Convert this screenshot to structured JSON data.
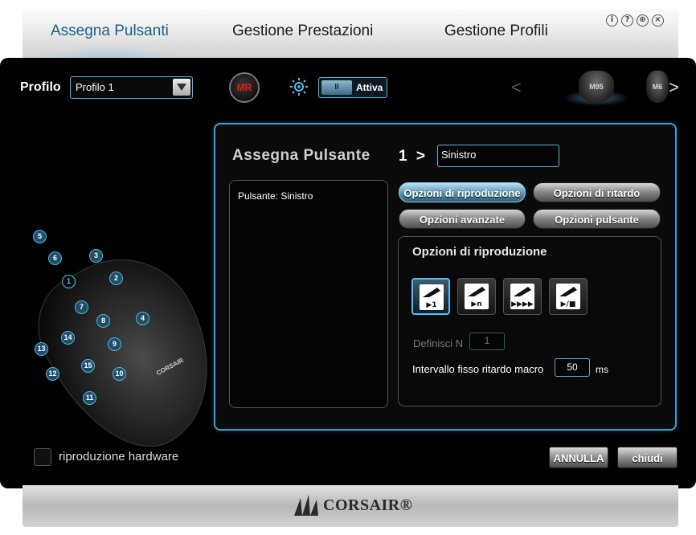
{
  "tabs": [
    {
      "label": "Assegna Pulsanti",
      "active": true
    },
    {
      "label": "Gestione Prestazioni",
      "active": false
    },
    {
      "label": "Gestione Profili",
      "active": false
    }
  ],
  "window_controls": [
    "info-icon",
    "help-icon",
    "globe-icon",
    "close-icon"
  ],
  "profile": {
    "label": "Profilo",
    "selected": "Profilo 1"
  },
  "macro_record": {
    "label": "MR"
  },
  "toggle": {
    "knob": "II",
    "label": "Attiva"
  },
  "mouse_carousel": {
    "items": [
      "M95",
      "M6"
    ]
  },
  "mouse_buttons": [
    "1",
    "2",
    "3",
    "4",
    "5",
    "6",
    "7",
    "8",
    "9",
    "10",
    "11",
    "12",
    "13",
    "14",
    "15"
  ],
  "mouse_brand": "CORSAIR",
  "assign": {
    "title": "Assegna Pulsante",
    "index": "1",
    "chevron": ">",
    "name_value": "Sinistro"
  },
  "list": {
    "items": [
      "Pulsante: Sinistro"
    ]
  },
  "option_buttons": {
    "playback": "Opzioni di riproduzione",
    "delay": "Opzioni di ritardo",
    "advanced": "Opzioni avanzate",
    "button": "Opzioni pulsante"
  },
  "playback_options": {
    "title": "Opzioni di riproduzione",
    "icons": [
      {
        "name": "play-once-icon",
        "symbol": "▶1"
      },
      {
        "name": "play-n-times-icon",
        "symbol": "▶n"
      },
      {
        "name": "play-repeat-icon",
        "symbol": "▶▶▶▶"
      },
      {
        "name": "play-toggle-icon",
        "symbol": "▶/■"
      }
    ],
    "define_n_label": "Definisci N",
    "define_n_value": "1",
    "delay_label": "Intervallo fisso ritardo macro",
    "delay_value": "50",
    "delay_unit": "ms"
  },
  "hardware_playback": {
    "label": "riproduzione hardware",
    "checked": false
  },
  "buttons": {
    "cancel": "ANNULLA",
    "close": "chiudi"
  },
  "footer": {
    "brand": "CORSAIR®"
  },
  "colors": {
    "accent": "#3a9fd0",
    "active_tab": "#1f5e86",
    "record": "#e01b1b"
  }
}
